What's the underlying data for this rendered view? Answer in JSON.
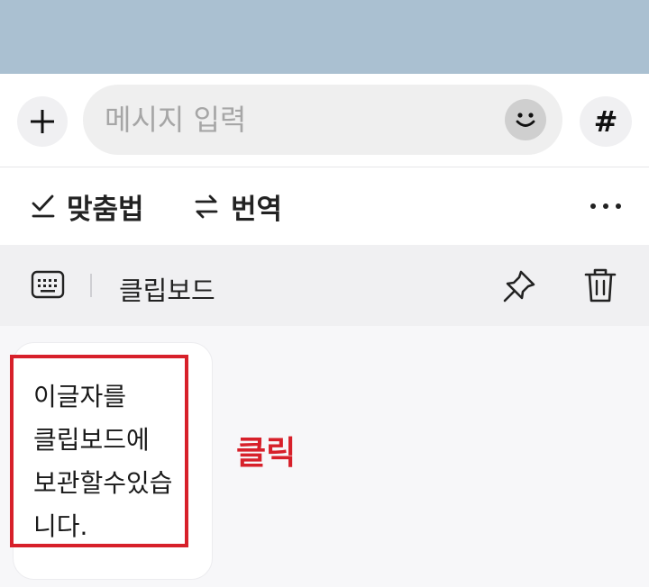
{
  "input_bar": {
    "plus_icon": "plus-icon",
    "message_placeholder": "메시지 입력",
    "message_value": "",
    "emoji_icon": "emoji-icon",
    "hash_label": "#"
  },
  "toolbar": {
    "spellcheck_label": "맞춤법",
    "translate_label": "번역",
    "more_icon": "more-horizontal-icon"
  },
  "clipboard": {
    "title": "클립보드",
    "keyboard_icon": "keyboard-icon",
    "pin_icon": "pin-icon",
    "trash_icon": "trash-icon",
    "item_lines": [
      "이글자를",
      "클립보드에",
      "보관할수있습",
      "니다."
    ]
  },
  "annotation": {
    "label": "클릭",
    "color": "#d7202a"
  },
  "colors": {
    "top_band": "#aac0d1",
    "accent_red": "#d7202a"
  }
}
